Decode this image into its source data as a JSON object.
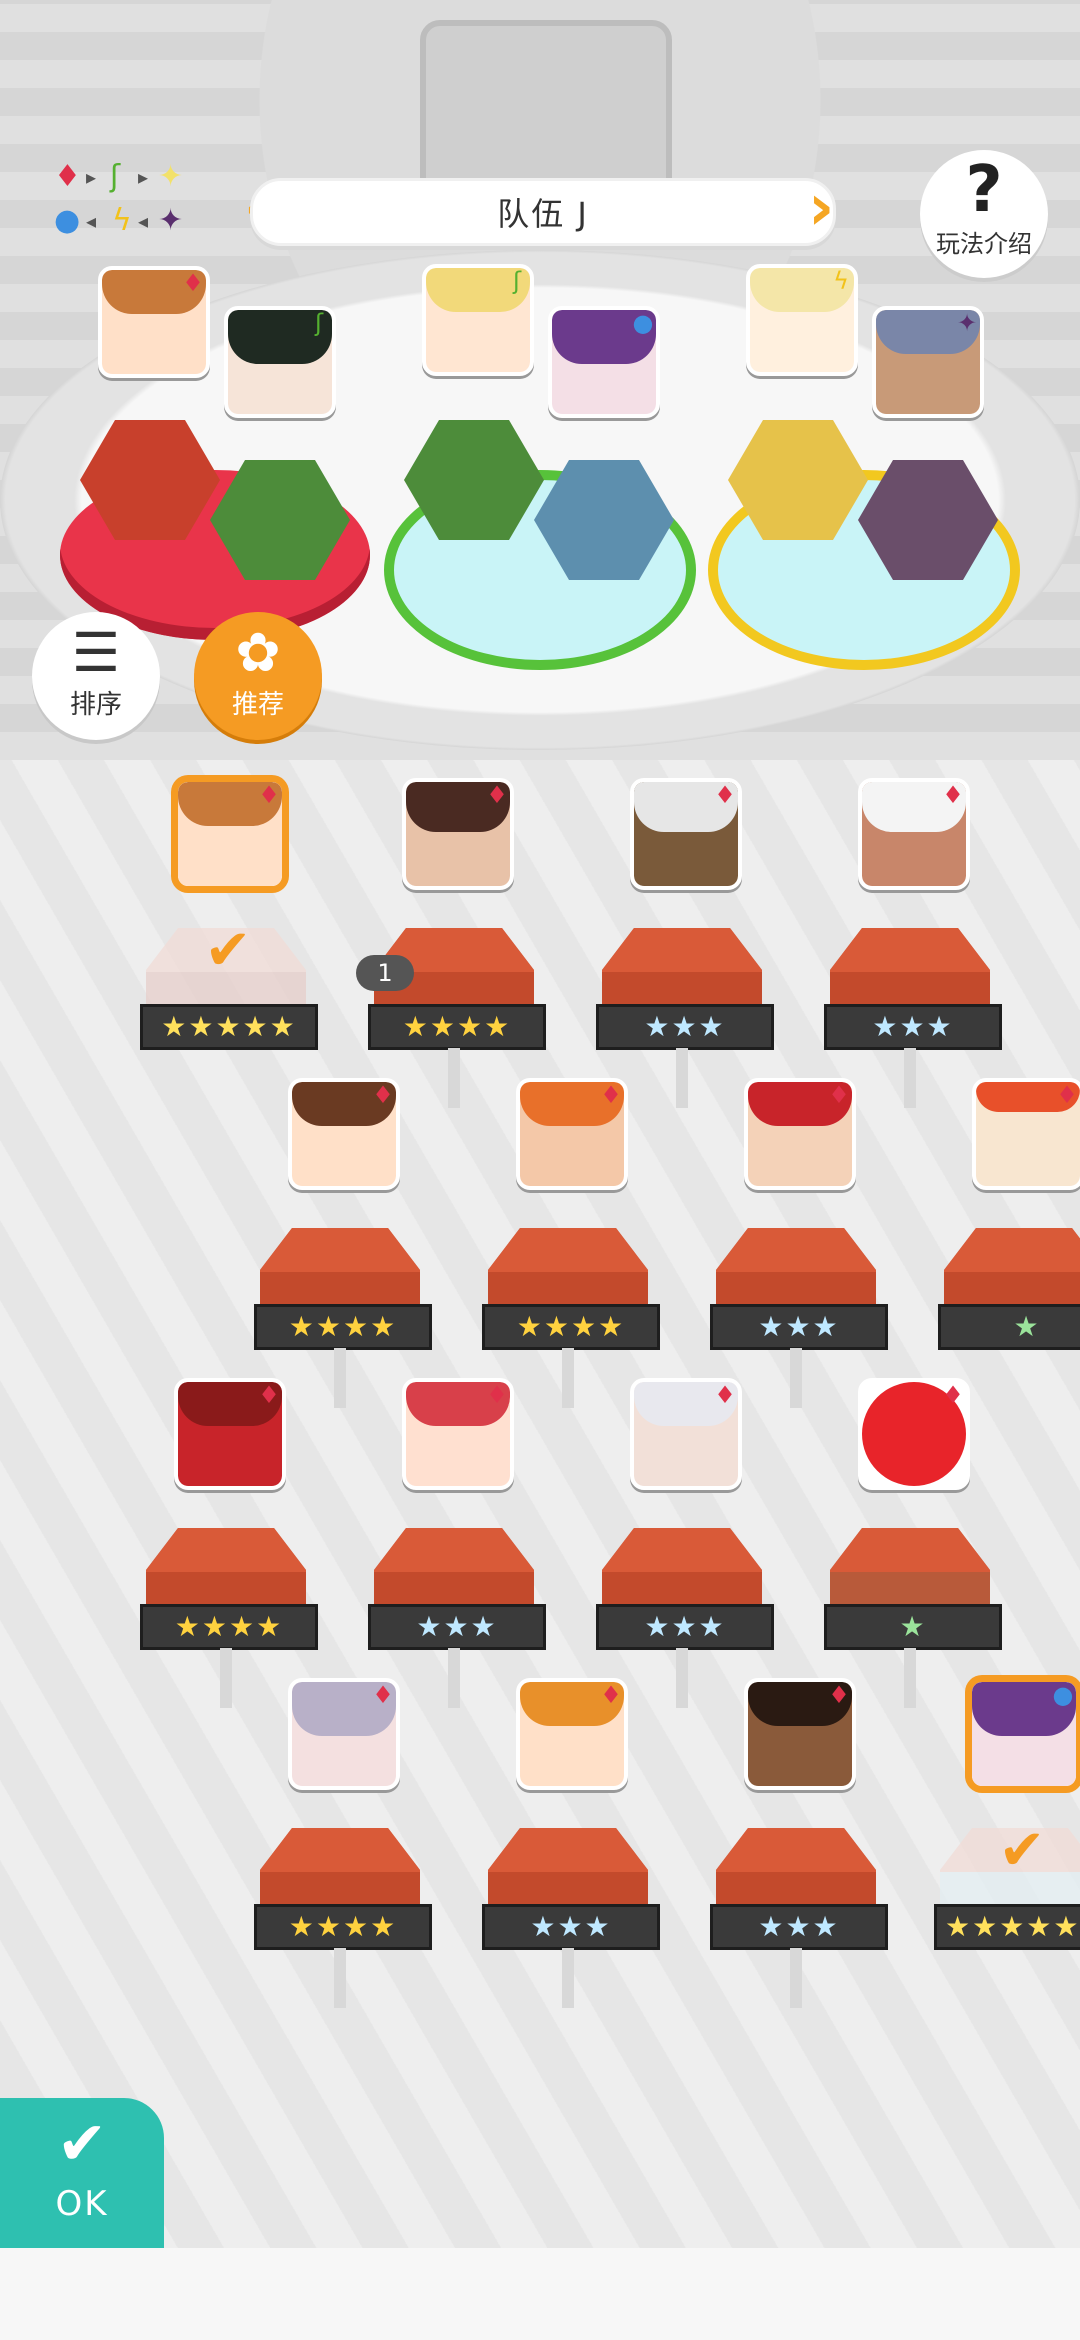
{
  "team": {
    "name": "队伍 J"
  },
  "help": {
    "label": "玩法介绍"
  },
  "buttons": {
    "sort": "排序",
    "recommend": "推荐",
    "ok": "OK"
  },
  "legend": {
    "row1": [
      "♦",
      "▸",
      "ʃ",
      "▸",
      "✦"
    ],
    "row2": [
      "●",
      "◂",
      "ϟ",
      "◂",
      "✦"
    ]
  },
  "roster_badge": "1",
  "ranks": {
    "r5": "★★★★★",
    "r4": "★★★★",
    "r3": "★★★",
    "r1": "★"
  },
  "colors": {
    "accent": "#f59b23",
    "ok": "#2ec0b0",
    "fire": "#e0304a",
    "leaf": "#55b030",
    "light": "#f2d13a",
    "water": "#3d8fe0",
    "dark": "#5a2f6e"
  }
}
